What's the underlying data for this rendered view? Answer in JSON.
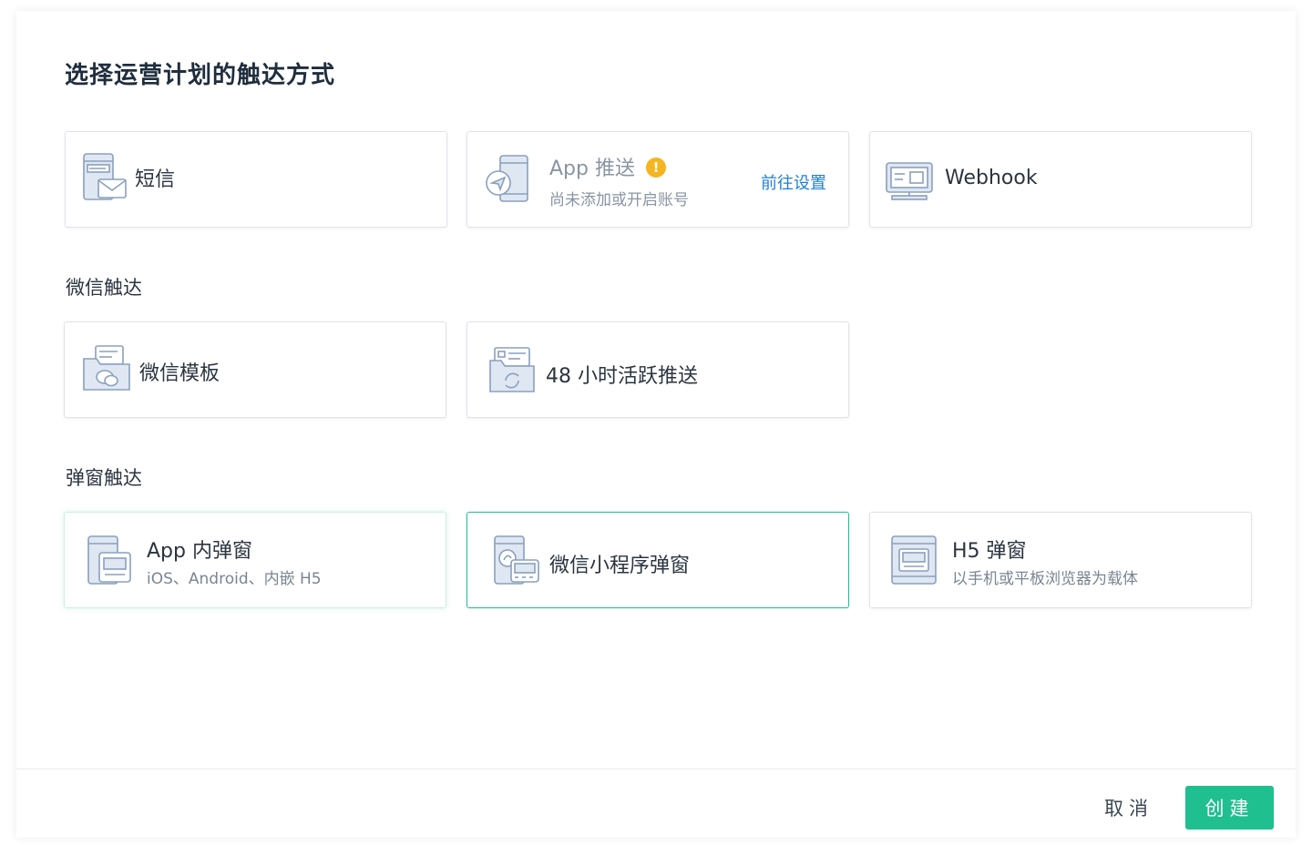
{
  "dialog": {
    "title": "选择运营计划的触达方式",
    "top_cards": [
      {
        "label": "短信",
        "icon": "sms-icon"
      },
      {
        "label": "App 推送",
        "sub": "尚未添加或开启账号",
        "link": "前往设置",
        "warn": "!",
        "icon": "app-push-icon"
      },
      {
        "label": "Webhook",
        "icon": "webhook-icon"
      }
    ],
    "wechat_section": {
      "label": "微信触达",
      "cards": [
        {
          "label": "微信模板",
          "icon": "wechat-template-icon"
        },
        {
          "label": "48 小时活跃推送",
          "icon": "wechat-active-push-icon"
        }
      ]
    },
    "popup_section": {
      "label": "弹窗触达",
      "cards": [
        {
          "label": "App 内弹窗",
          "sub": "iOS、Android、内嵌 H5",
          "icon": "app-popup-icon"
        },
        {
          "label": "微信小程序弹窗",
          "icon": "mini-program-popup-icon",
          "selected": true
        },
        {
          "label": "H5 弹窗",
          "sub": "以手机或平板浏览器为载体",
          "icon": "h5-popup-icon"
        }
      ]
    },
    "footer": {
      "cancel": "取消",
      "create": "创建"
    },
    "colors": {
      "accent": "#1fbf8f",
      "link": "#1e7fd6",
      "warning": "#f5b522"
    }
  }
}
